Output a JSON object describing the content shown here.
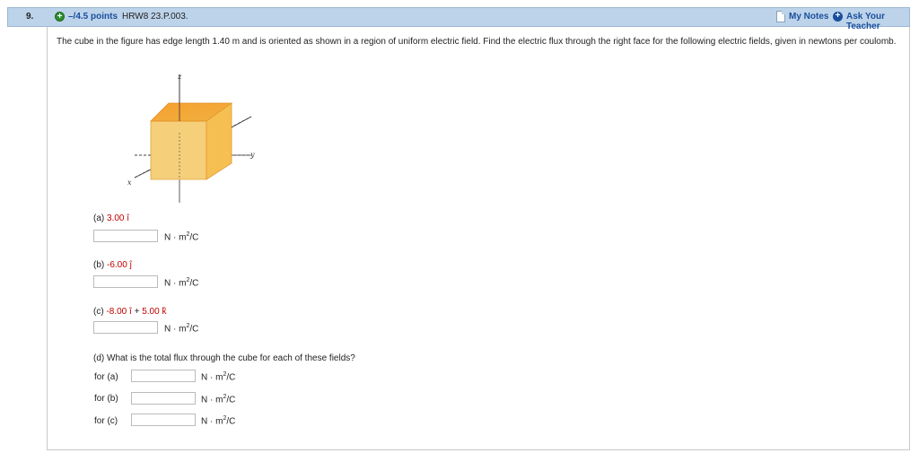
{
  "header": {
    "number": "9.",
    "points": "–/4.5 points",
    "source": "HRW8 23.P.003.",
    "my_notes": "My Notes",
    "ask_teacher": "Ask Your Teacher"
  },
  "question": "The cube in the figure has edge length 1.40 m and is oriented as shown in a region of uniform electric field. Find the electric flux through the right face for the following electric fields, given in newtons per coulomb.",
  "figure": {
    "x_label": "x",
    "y_label": "y",
    "z_label": "z"
  },
  "unit": "N · m",
  "unit_tail": "/C",
  "parts": {
    "a": {
      "label": "(a)",
      "value": "3.00 î",
      "answer": ""
    },
    "b": {
      "label": "(b)",
      "value": "-6.00 ĵ",
      "answer": ""
    },
    "c": {
      "label": "(c)",
      "value1": "-8.00 î",
      "plus": "+",
      "value2": "5.00 k̂",
      "answer": ""
    }
  },
  "part_d": {
    "prompt": "(d) What is the total flux through the cube for each of these fields?",
    "rows": [
      {
        "label": "for (a)",
        "answer": ""
      },
      {
        "label": "for (b)",
        "answer": ""
      },
      {
        "label": "for (c)",
        "answer": ""
      }
    ]
  }
}
